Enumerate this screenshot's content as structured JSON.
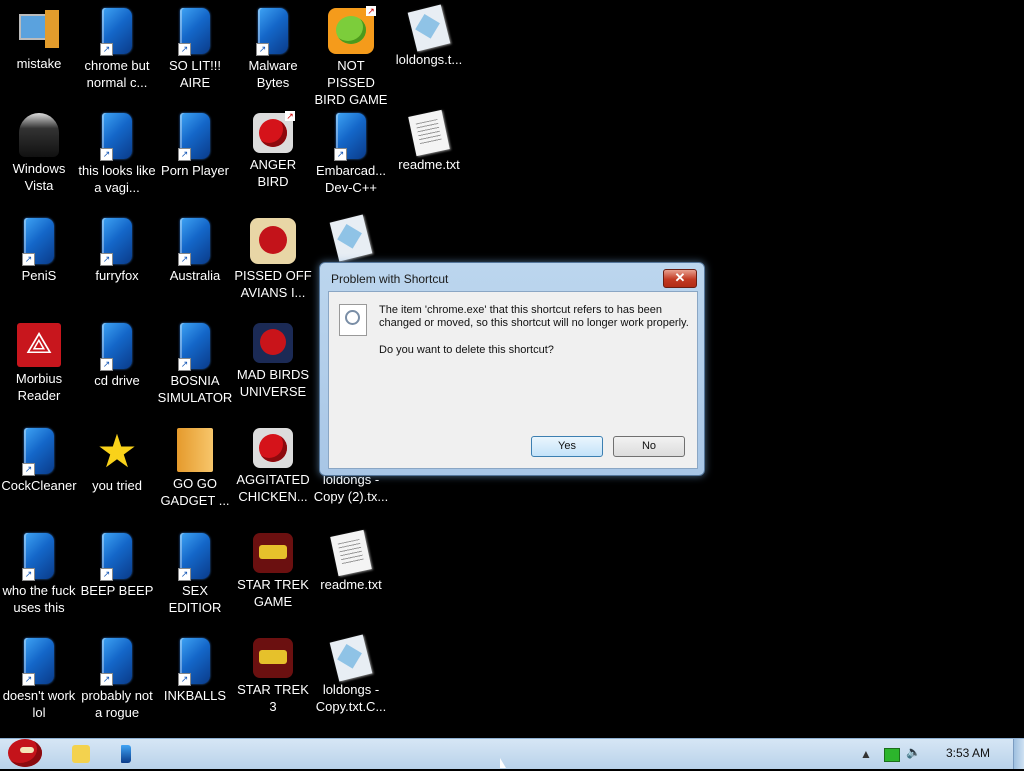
{
  "desktop": {
    "icons": [
      {
        "label": "mistake",
        "icon": "computer-icon"
      },
      {
        "label": "chrome but normal c...",
        "icon": "blue-app-icon"
      },
      {
        "label": "SO LIT!!! AIRE",
        "icon": "blue-app-icon"
      },
      {
        "label": "Malware Bytes",
        "icon": "blue-app-icon"
      },
      {
        "label": "NOT PISSED BIRD GAME",
        "icon": "green-pig-icon"
      },
      {
        "label": "loldongs.t...",
        "icon": "notepad-icon"
      },
      {
        "label": "Windows Vista",
        "icon": "trash-icon"
      },
      {
        "label": "this looks like a vagi...",
        "icon": "blue-app-icon"
      },
      {
        "label": "Porn Player",
        "icon": "blue-app-icon"
      },
      {
        "label": "ANGER BIRD",
        "icon": "red-bird-icon"
      },
      {
        "label": "Embarcad... Dev-C++",
        "icon": "blue-app-icon"
      },
      {
        "label": "readme.txt",
        "icon": "document-icon"
      },
      {
        "label": "PeniS",
        "icon": "blue-app-icon"
      },
      {
        "label": "furryfox",
        "icon": "blue-app-icon"
      },
      {
        "label": "Australia",
        "icon": "blue-app-icon"
      },
      {
        "label": "PISSED OFF AVIANS I...",
        "icon": "seasons-bird-icon"
      },
      {
        "label": "",
        "icon": "notepad-icon"
      },
      {
        "label": "Morbius Reader",
        "icon": "pdf-icon"
      },
      {
        "label": "cd drive",
        "icon": "blue-app-icon"
      },
      {
        "label": "BOSNIA SIMULATOR",
        "icon": "blue-app-icon"
      },
      {
        "label": "MAD BIRDS UNIVERSE",
        "icon": "space-bird-icon"
      },
      {
        "label": "CockCleaner",
        "icon": "blue-app-icon"
      },
      {
        "label": "you tried",
        "icon": "star-icon"
      },
      {
        "label": "GO GO GADGET ...",
        "icon": "folder-icon"
      },
      {
        "label": "AGGITATED CHICKEN...",
        "icon": "red-bird-icon"
      },
      {
        "label": "loldongs - Copy (2).tx...",
        "icon": "document-icon"
      },
      {
        "label": "who the fuck uses this",
        "icon": "blue-app-icon"
      },
      {
        "label": "BEEP BEEP",
        "icon": "blue-app-icon"
      },
      {
        "label": "SEX EDITIOR",
        "icon": "blue-app-icon"
      },
      {
        "label": "STAR TREK GAME",
        "icon": "starwars-bird-icon"
      },
      {
        "label": "readme.txt",
        "icon": "document-icon"
      },
      {
        "label": "doesn't work lol",
        "icon": "blue-app-icon"
      },
      {
        "label": "probably not a rogue",
        "icon": "blue-app-icon"
      },
      {
        "label": "INKBALLS",
        "icon": "blue-app-icon"
      },
      {
        "label": "STAR TREK 3",
        "icon": "starwars-bird-icon"
      },
      {
        "label": "loldongs - Copy.txt.C...",
        "icon": "notepad-icon"
      }
    ]
  },
  "dialog": {
    "title": "Problem with Shortcut",
    "close_label": "✕",
    "message": "The item 'chrome.exe' that this shortcut refers to has been changed or moved, so this shortcut will no longer work properly.",
    "question": "Do you want to delete this shortcut?",
    "yes_label": "Yes",
    "no_label": "No"
  },
  "taskbar": {
    "tray_arrow": "▲",
    "volume": "🔈",
    "clock": "3:53 AM"
  }
}
